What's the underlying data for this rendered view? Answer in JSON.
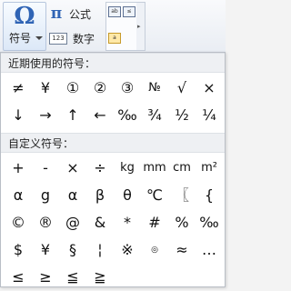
{
  "ribbon": {
    "symbol_glyph": "Ω",
    "symbol_label": "符号",
    "formula_glyph": "π",
    "formula_label": "公式",
    "number_glyph": "123",
    "number_label": "数字",
    "gallery_icons": [
      "ab",
      "≤",
      "a"
    ]
  },
  "recent": {
    "title": "近期使用的符号：",
    "rows": [
      [
        "≠",
        "¥",
        "①",
        "②",
        "③",
        "№",
        "√",
        "×"
      ],
      [
        "↓",
        "→",
        "↑",
        "←",
        "‰",
        "¾",
        "½",
        "¼"
      ]
    ]
  },
  "custom": {
    "title": "自定义符号：",
    "rows": [
      [
        "+",
        "-",
        "×",
        "÷",
        "kg",
        "mm",
        "cm",
        "m²"
      ],
      [
        "α",
        "g",
        "α",
        "β",
        "θ",
        "℃",
        "〖",
        "{"
      ],
      [
        "©",
        "®",
        "@",
        "&",
        "*",
        "#",
        "%",
        "‰"
      ],
      [
        "$",
        "¥",
        "§",
        "¦",
        "※",
        "◎",
        "≈",
        "…"
      ],
      [
        "≤",
        "≥",
        "≦",
        "≧"
      ]
    ]
  }
}
